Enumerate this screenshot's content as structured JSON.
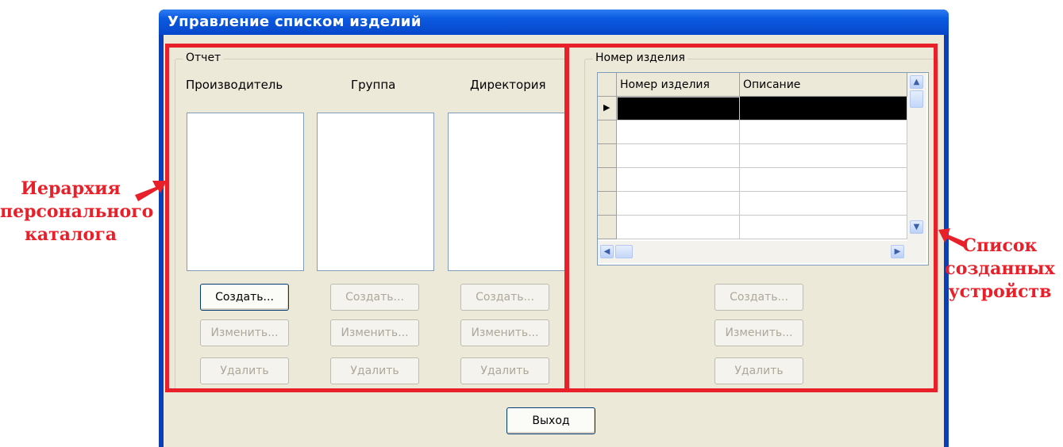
{
  "window": {
    "title": "Управление списком изделий"
  },
  "report_group": {
    "caption": "Отчет",
    "columns": [
      {
        "label": "Производитель",
        "buttons": {
          "create": "Создать...",
          "edit": "Изменить...",
          "delete": "Удалить"
        },
        "create_enabled": true
      },
      {
        "label": "Группа",
        "buttons": {
          "create": "Создать...",
          "edit": "Изменить...",
          "delete": "Удалить"
        },
        "create_enabled": false
      },
      {
        "label": "Директория",
        "buttons": {
          "create": "Создать...",
          "edit": "Изменить...",
          "delete": "Удалить"
        },
        "create_enabled": false
      }
    ]
  },
  "items_group": {
    "caption": "Номер изделия",
    "grid": {
      "columns": [
        "Номер изделия",
        "Описание"
      ],
      "rows": [
        [
          "",
          ""
        ],
        [
          "",
          ""
        ],
        [
          "",
          ""
        ],
        [
          "",
          ""
        ],
        [
          "",
          ""
        ],
        [
          "",
          ""
        ]
      ],
      "selected_row": 0
    },
    "buttons": {
      "create": "Создать...",
      "edit": "Изменить...",
      "delete": "Удалить"
    }
  },
  "footer": {
    "exit_button": "Выход"
  },
  "annotations": {
    "left": [
      "Иерархия",
      "персонального",
      "каталога"
    ],
    "right": [
      "Список",
      "созданных",
      "устройств"
    ],
    "color": "#e8202a"
  },
  "colors": {
    "title_bar": "#0a5ae0",
    "client_bg": "#ece9d8",
    "annotation": "#e8202a"
  }
}
